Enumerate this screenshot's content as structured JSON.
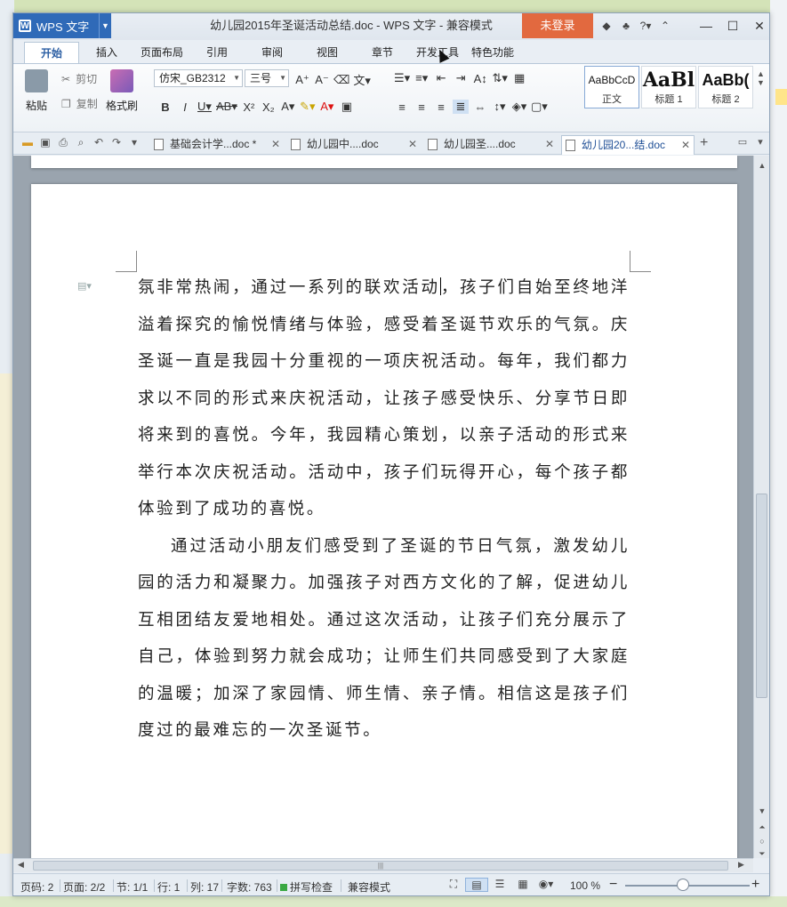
{
  "window": {
    "app_name": "WPS 文字",
    "title": "幼儿园2015年圣诞活动总结.doc - WPS 文字 - 兼容模式",
    "login_label": "未登录"
  },
  "ribbon_tabs": [
    "开始",
    "插入",
    "页面布局",
    "引用",
    "审阅",
    "视图",
    "章节",
    "开发工具",
    "特色功能"
  ],
  "ribbon": {
    "paste": "粘贴",
    "cut": "剪切",
    "copy": "复制",
    "format_painter": "格式刷",
    "font_name": "仿宋_GB2312",
    "font_size": "三号",
    "styles": [
      {
        "sample": "AaBbCcD",
        "name": "正文"
      },
      {
        "sample": "AaBl",
        "name": "标题 1"
      },
      {
        "sample": "AaBb(",
        "name": "标题 2"
      }
    ]
  },
  "doc_tabs": [
    {
      "label": "基础会计学...doc *"
    },
    {
      "label": "幼儿园中....doc"
    },
    {
      "label": "幼儿园圣....doc"
    },
    {
      "label": "幼儿园20...结.doc"
    }
  ],
  "document": {
    "paragraph1_a": "氛非常热闹，通过一系列的联欢活动",
    "paragraph1_b": "，孩子们自始至终地洋溢着探究的愉悦情绪与体验，感受着圣诞节欢乐的气氛。庆圣诞一直是我园十分重视的一项庆祝活动。每年，我们都力求以不同的形式来庆祝活动，让孩子感受快乐、分享节日即将来到的喜悦。今年，我园精心策划，以亲子活动的形式来举行本次庆祝活动。活动中，孩子们玩得开心，每个孩子都体验到了成功的喜悦。",
    "paragraph2": "通过活动小朋友们感受到了圣诞的节日气氛，激发幼儿园的活力和凝聚力。加强孩子对西方文化的了解，促进幼儿互相团结友爱地相处。通过这次活动，让孩子们充分展示了自己，体验到努力就会成功；让师生们共同感受到了大家庭的温暖；加深了家园情、师生情、亲子情。相信这是孩子们度过的最难忘的一次圣诞节。"
  },
  "status_bar": {
    "page_num": "页码: 2",
    "pages": "页面: 2/2",
    "section": "节: 1/1",
    "row": "行: 1",
    "col": "列: 17",
    "word_count": "字数: 763",
    "spell_check": "拼写检查",
    "compat_mode": "兼容模式",
    "zoom": "100 %"
  }
}
